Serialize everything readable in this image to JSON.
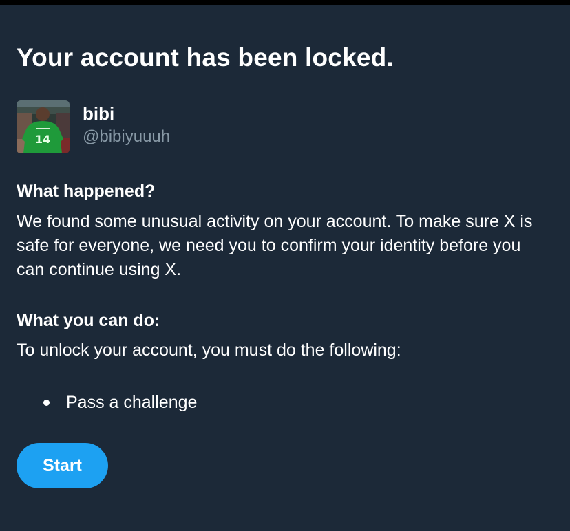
{
  "header": {
    "title": "Your account has been locked."
  },
  "profile": {
    "display_name": "bibi",
    "handle": "@bibiyuuuh",
    "avatar_icon": "profile-photo-soccer-player",
    "jersey_number": "14",
    "jersey_color": "#1f9a3a"
  },
  "what_happened": {
    "heading": "What happened?",
    "body": "We found some unusual activity on your account. To make sure X is safe for everyone, we need you to confirm your identity before you can continue using X."
  },
  "what_you_can_do": {
    "heading": "What you can do:",
    "body": "To unlock your account, you must do the following:",
    "steps": [
      {
        "label": "Pass a challenge",
        "icon": "bullet-dot"
      }
    ]
  },
  "actions": {
    "start_label": "Start"
  },
  "colors": {
    "background": "#1c2938",
    "primary_text": "#ffffff",
    "secondary_text": "#8899a6",
    "accent": "#1da1f2"
  }
}
